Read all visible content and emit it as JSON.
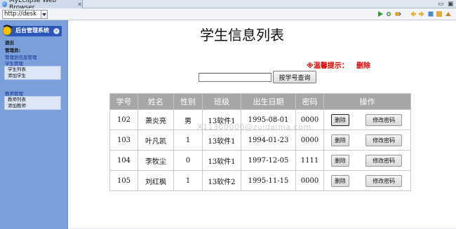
{
  "browser": {
    "tab_title": "MyEclipse Web Browser",
    "tab_close": "✕",
    "url": "http://desk",
    "min": "▭",
    "max": "▣"
  },
  "sidebar": {
    "title": "后台管理系统",
    "collapse_symbol": "«",
    "logout": "退出",
    "admin_label": "管理员:",
    "admin_info": "管理员信息管理",
    "student_mgmt": "学生管理",
    "student_items": [
      "学生列表",
      "添加学生"
    ],
    "teacher_mgmt": "教师管理",
    "teacher_items": [
      "教师列表",
      "添加教师"
    ]
  },
  "main": {
    "title": "学生信息列表",
    "tip_label": "※温馨提示：",
    "tip_action": "删除",
    "search_placeholder": "",
    "search_button": "按学号查询"
  },
  "table": {
    "headers": [
      "学号",
      "姓名",
      "性别",
      "班级",
      "出生日期",
      "密码",
      "操作"
    ],
    "rows": [
      [
        "102",
        "萧炎亮",
        "男",
        "13软件1",
        "1995-08-01",
        "0000"
      ],
      [
        "103",
        "叶凡凯",
        "1",
        "13软件1",
        "1994-01-23",
        "0000"
      ],
      [
        "104",
        "李牧尘",
        "0",
        "13软件1",
        "1997-12-05",
        "1111"
      ],
      [
        "105",
        "刘红枫",
        "1",
        "13软件2",
        "1995-11-15",
        "0000"
      ]
    ],
    "delete_label": "删除",
    "change_pwd_label": "修改密码"
  },
  "watermark": "X11300000@zuidaima.com",
  "colors": {
    "sidebar_bg": "#7a9fda",
    "sidebar_header": "#2a56b8",
    "table_header_bg": "#a6a6a6",
    "tip_red": "#e00000"
  }
}
